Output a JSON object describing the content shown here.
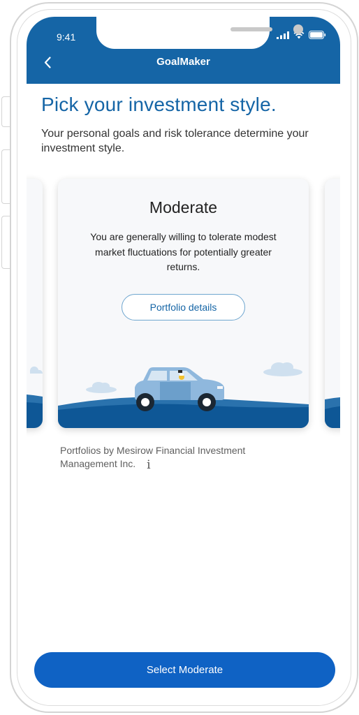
{
  "status_bar": {
    "time": "9:41"
  },
  "header": {
    "title": "GoalMaker"
  },
  "page": {
    "title": "Pick your investment style.",
    "subtitle": "Your personal goals and risk tolerance determine your investment style."
  },
  "card": {
    "title": "Moderate",
    "description": "You are generally willing to tolerate modest market fluctuations for potentially greater returns.",
    "details_button": "Portfolio details"
  },
  "footnote": {
    "text": "Portfolios by Mesirow Financial Investment Management Inc.",
    "info_glyph": "i"
  },
  "actions": {
    "select_label": "Select Moderate"
  },
  "colors": {
    "brand_blue": "#1565a6",
    "button_blue": "#0f62c4",
    "hill_dark": "#0e5796",
    "car_light": "#8fb8dd"
  }
}
